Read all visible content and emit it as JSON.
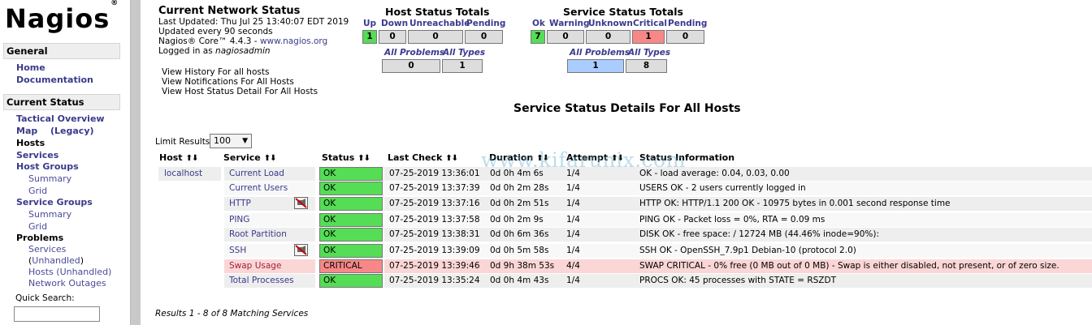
{
  "sidebar": {
    "logo": "Nagios",
    "logo_mark": "®",
    "general_header": "General",
    "home": "Home",
    "documentation": "Documentation",
    "current_status_header": "Current Status",
    "tactical_overview": "Tactical Overview",
    "map": "Map",
    "legacy": "(Legacy)",
    "hosts": "Hosts",
    "services": "Services",
    "host_groups": "Host Groups",
    "hg_summary": "Summary",
    "hg_grid": "Grid",
    "service_groups": "Service Groups",
    "sg_summary": "Summary",
    "sg_grid": "Grid",
    "problems": "Problems",
    "p_services": "Services",
    "p_unhandled_label": "Unhandled",
    "p_hosts": "Hosts (Unhandled)",
    "p_outages": "Network Outages",
    "quick_search_label": "Quick Search:",
    "quick_search_value": ""
  },
  "info": {
    "title": "Current Network Status",
    "last_updated": "Last Updated: Thu Jul 25 13:40:07 EDT 2019",
    "update_freq": "Updated every 90 seconds",
    "core_prefix": "Nagios® Core™ 4.4.3 - ",
    "core_link": "www.nagios.org",
    "logged_prefix": "Logged in as ",
    "logged_user": "nagiosadmin",
    "history_link": "View History For all hosts",
    "notifications_link": "View Notifications For All Hosts",
    "host_status_link": "View Host Status Detail For All Hosts"
  },
  "host_totals": {
    "title": "Host Status Totals",
    "headers": [
      "Up",
      "Down",
      "Unreachable",
      "Pending"
    ],
    "values": [
      "1",
      "0",
      "0",
      "0"
    ],
    "all_problems_label": "All Problems",
    "all_types_label": "All Types",
    "all_problems": "0",
    "all_types": "1"
  },
  "service_totals": {
    "title": "Service Status Totals",
    "headers": [
      "Ok",
      "Warning",
      "Unknown",
      "Critical",
      "Pending"
    ],
    "values": [
      "7",
      "0",
      "0",
      "1",
      "0"
    ],
    "all_problems_label": "All Problems",
    "all_types_label": "All Types",
    "all_problems": "1",
    "all_types": "8"
  },
  "page_title": "Service Status Details For All Hosts",
  "limit": {
    "label": "Limit Results:",
    "value": "100",
    "arrow": "▼"
  },
  "watermark": "www.kifarunix.com",
  "table": {
    "sort_glyph": "⬆⬇",
    "headers": {
      "host": "Host",
      "service": "Service",
      "status": "Status",
      "last_check": "Last Check",
      "duration": "Duration",
      "attempt": "Attempt",
      "status_info": "Status Information"
    },
    "host": "localhost",
    "rows": [
      {
        "service": "Current Load",
        "status": "OK",
        "last_check": "07-25-2019 13:36:01",
        "duration": "0d 0h 4m 6s",
        "attempt": "1/4",
        "info": "OK - load average: 0.04, 0.03, 0.00"
      },
      {
        "service": "Current Users",
        "status": "OK",
        "last_check": "07-25-2019 13:37:39",
        "duration": "0d 0h 2m 28s",
        "attempt": "1/4",
        "info": "USERS OK - 2 users currently logged in"
      },
      {
        "service": "HTTP",
        "status": "OK",
        "last_check": "07-25-2019 13:37:16",
        "duration": "0d 0h 2m 51s",
        "attempt": "1/4",
        "info": "HTTP OK: HTTP/1.1 200 OK - 10975 bytes in 0.001 second response time"
      },
      {
        "service": "PING",
        "status": "OK",
        "last_check": "07-25-2019 13:37:58",
        "duration": "0d 0h 2m 9s",
        "attempt": "1/4",
        "info": "PING OK - Packet loss = 0%, RTA = 0.09 ms"
      },
      {
        "service": "Root Partition",
        "status": "OK",
        "last_check": "07-25-2019 13:38:31",
        "duration": "0d 0h 6m 36s",
        "attempt": "1/4",
        "info": "DISK OK - free space: / 12724 MB (44.46% inode=90%):"
      },
      {
        "service": "SSH",
        "status": "OK",
        "last_check": "07-25-2019 13:39:09",
        "duration": "0d 0h 5m 58s",
        "attempt": "1/4",
        "info": "SSH OK - OpenSSH_7.9p1 Debian-10 (protocol 2.0)"
      },
      {
        "service": "Swap Usage",
        "status": "CRITICAL",
        "last_check": "07-25-2019 13:39:46",
        "duration": "0d 9h 38m 53s",
        "attempt": "4/4",
        "info": "SWAP CRITICAL - 0% free (0 MB out of 0 MB) - Swap is either disabled, not present, or of zero size."
      },
      {
        "service": "Total Processes",
        "status": "OK",
        "last_check": "07-25-2019 13:35:24",
        "duration": "0d 0h 4m 43s",
        "attempt": "1/4",
        "info": "PROCS OK: 45 processes with STATE = RSZDT"
      }
    ]
  },
  "results": "Results 1 - 8 of 8 Matching Services",
  "icons": {
    "notifications_disabled": "notifications-disabled-icon"
  },
  "colors": {
    "ok": "#55dd55",
    "critical": "#f88888",
    "link": "#3a3a8c",
    "highlight": "#aaccff"
  }
}
